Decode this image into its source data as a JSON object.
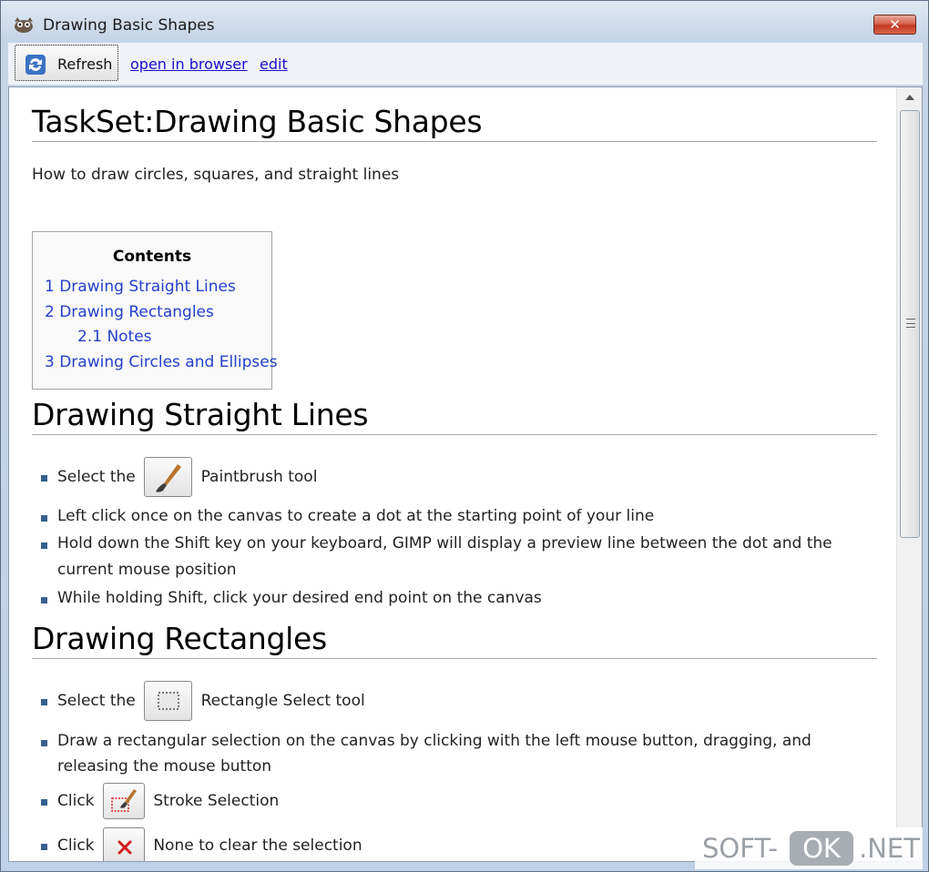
{
  "window": {
    "title": "Drawing Basic Shapes",
    "close_label": "✕"
  },
  "toolbar": {
    "refresh_label": "Refresh",
    "open_in_browser": "open in browser",
    "edit": "edit"
  },
  "page": {
    "title": "TaskSet:Drawing Basic Shapes",
    "subtitle": "How to draw circles, squares, and straight lines",
    "toc": {
      "title": "Contents",
      "items": [
        "1 Drawing Straight Lines",
        "2 Drawing Rectangles",
        "2.1 Notes",
        "3 Drawing Circles and Ellipses"
      ]
    },
    "sections": [
      {
        "heading": "Drawing Straight Lines",
        "items": [
          {
            "before": "Select the",
            "icon": "paintbrush-icon",
            "after": "Paintbrush tool"
          },
          {
            "text": "Left click once on the canvas to create a dot at the starting point of your line"
          },
          {
            "text1": "Hold down the Shift key on your keyboard, GIMP will display a preview line between the dot and the",
            "text2": "current mouse position"
          },
          {
            "text": "While holding Shift, click your desired end point on the canvas"
          }
        ]
      },
      {
        "heading": "Drawing Rectangles",
        "items": [
          {
            "before": "Select the",
            "icon": "rectangle-select-icon",
            "after": "Rectangle Select tool"
          },
          {
            "text1": "Draw a rectangular selection on the canvas by clicking with the left mouse button, dragging, and",
            "text2": "releasing the mouse button"
          },
          {
            "before": "Click",
            "icon": "stroke-selection-icon",
            "after": "Stroke Selection"
          },
          {
            "before": "Click",
            "icon": "select-none-icon",
            "after": "None to clear the selection"
          }
        ]
      }
    ]
  },
  "watermark": {
    "left": "SOFT-",
    "ok": "OK",
    "right": ".NET"
  },
  "colors": {
    "link": "#2540cc",
    "bullet": "#365f91",
    "close": "#c2381f"
  }
}
